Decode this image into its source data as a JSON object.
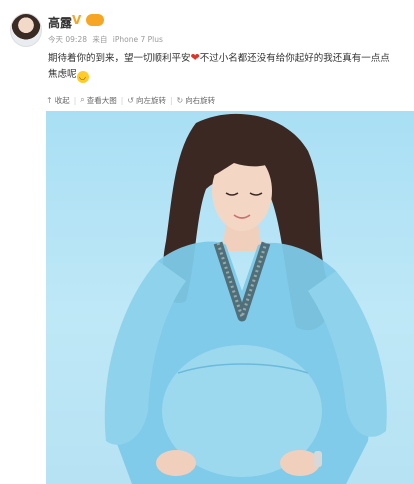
{
  "post": {
    "username": "高露",
    "verified_badge": "V",
    "vip_badge": "",
    "time": "今天 09:28",
    "source_prefix": "来自",
    "source": "iPhone 7 Plus",
    "text_line1_a": "期待着你的到来，望一切顺利平安",
    "text_line1_b": "不过小名都还没有给你起好的我还真有一点点",
    "text_line2": "焦虑呢",
    "heart_icon": "red-heart-icon",
    "smiley_icon": "smile-emoji-icon"
  },
  "toolbar": {
    "favorite": "收起",
    "view_large": "查看大图",
    "rotate_left": "向左旋转",
    "rotate_right": "向右旋转"
  },
  "colors": {
    "text": "#333333",
    "meta": "#999999",
    "photo_bg": "#a9dff4",
    "dress": "#7cc9e8"
  }
}
